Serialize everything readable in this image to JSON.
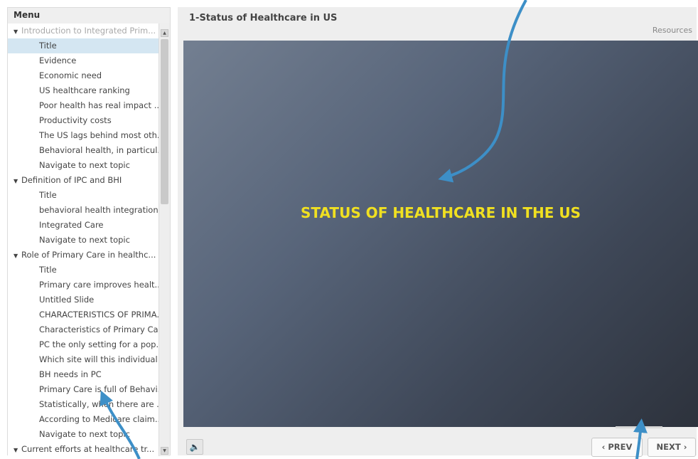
{
  "sidebar": {
    "header": "Menu",
    "items": [
      {
        "type": "section",
        "label": "Introduction to Integrated Prim...",
        "dim": true
      },
      {
        "type": "item",
        "label": "Title",
        "selected": true
      },
      {
        "type": "item",
        "label": "Evidence"
      },
      {
        "type": "item",
        "label": "Economic need"
      },
      {
        "type": "item",
        "label": "US healthcare ranking"
      },
      {
        "type": "item",
        "label": "Poor health has real impact ..."
      },
      {
        "type": "item",
        "label": "Productivity costs"
      },
      {
        "type": "item",
        "label": "The US lags behind most oth..."
      },
      {
        "type": "item",
        "label": "Behavioral health, in particul..."
      },
      {
        "type": "item",
        "label": "Navigate to next topic"
      },
      {
        "type": "section",
        "label": "Definition of IPC and BHI"
      },
      {
        "type": "item",
        "label": "Title"
      },
      {
        "type": "item",
        "label": "behavioral health integration"
      },
      {
        "type": "item",
        "label": "Integrated Care"
      },
      {
        "type": "item",
        "label": "Navigate to next topic"
      },
      {
        "type": "section",
        "label": "Role of Primary Care in healthc..."
      },
      {
        "type": "item",
        "label": "Title"
      },
      {
        "type": "item",
        "label": "Primary care improves healt..."
      },
      {
        "type": "item",
        "label": "Untitled Slide"
      },
      {
        "type": "item",
        "label": "CHARACTERISTICS OF PRIMA..."
      },
      {
        "type": "item",
        "label": "Characteristics of Primary Care"
      },
      {
        "type": "item",
        "label": "PC the only setting for a pop..."
      },
      {
        "type": "item",
        "label": "Which site will this individual ..."
      },
      {
        "type": "item",
        "label": "BH needs in PC"
      },
      {
        "type": "item",
        "label": "Primary Care is full of Behavi..."
      },
      {
        "type": "item",
        "label": "Statistically, when there are ..."
      },
      {
        "type": "item",
        "label": "According to Medicare claim..."
      },
      {
        "type": "item",
        "label": "Navigate to next topic"
      },
      {
        "type": "section",
        "label": "Current efforts at healthcare tr..."
      }
    ]
  },
  "main": {
    "title": "1-Status of Healthcare in US",
    "resources": "Resources",
    "slide_title": "STATUS OF HEALTHCARE IN THE US",
    "slide_title_color": "#f0e021"
  },
  "controls": {
    "audio_icon": "speaker-icon",
    "prev_label": "‹ PREV",
    "next_label": "NEXT ›"
  },
  "annotation_color": "#3d8fc7"
}
